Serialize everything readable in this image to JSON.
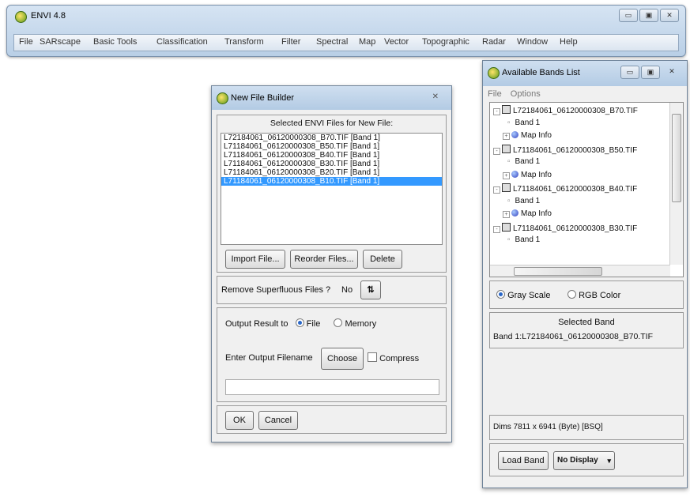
{
  "envi": {
    "title": "ENVI 4.8",
    "menu": [
      "File",
      "SARscape",
      "Basic Tools",
      "Classification",
      "Transform",
      "Filter",
      "Spectral",
      "Map",
      "Vector",
      "Topographic",
      "Radar",
      "Window",
      "Help"
    ],
    "controls": [
      "▭",
      "▣",
      "✕"
    ]
  },
  "new_file_builder": {
    "title": "New File Builder",
    "close": "✕",
    "selected_label": "Selected ENVI Files for New File:",
    "files": [
      "L72184061_06120000308_B70.TIF [Band 1]",
      "L71184061_06120000308_B50.TIF [Band 1]",
      "L71184061_06120000308_B40.TIF [Band 1]",
      "L71184061_06120000308_B30.TIF [Band 1]",
      "L71184061_06120000308_B20.TIF [Band 1]",
      "L71184061_06120000308_B10.TIF [Band 1]"
    ],
    "selected_index": 5,
    "import_button": "Import File...",
    "reorder_button": "Reorder Files...",
    "delete_button": "Delete",
    "remove_label": "Remove Superfluous Files ?",
    "remove_value": "No",
    "toggle_glyph": "⇅",
    "output_label": "Output Result to",
    "output_file": "File",
    "output_memory": "Memory",
    "output_selected": "File",
    "filename_label": "Enter Output Filename",
    "choose_button": "Choose",
    "compress_label": "Compress",
    "filename_value": "",
    "ok_button": "OK",
    "cancel_button": "Cancel"
  },
  "bands_list": {
    "title": "Available Bands List",
    "controls": [
      "▭",
      "▣",
      "✕"
    ],
    "menu": [
      "File",
      "Options"
    ],
    "tree": [
      {
        "type": "file",
        "label": "L72184061_06120000308_B70.TIF"
      },
      {
        "type": "band",
        "label": "Band 1"
      },
      {
        "type": "mapinfo",
        "label": "Map Info"
      },
      {
        "type": "file",
        "label": "L71184061_06120000308_B50.TIF"
      },
      {
        "type": "band",
        "label": "Band 1"
      },
      {
        "type": "mapinfo",
        "label": "Map Info"
      },
      {
        "type": "file",
        "label": "L71184061_06120000308_B40.TIF"
      },
      {
        "type": "band",
        "label": "Band 1"
      },
      {
        "type": "mapinfo",
        "label": "Map Info"
      },
      {
        "type": "file",
        "label": "L71184061_06120000308_B30.TIF"
      },
      {
        "type": "band",
        "label": "Band 1"
      }
    ],
    "gray_scale": "Gray Scale",
    "rgb_color": "RGB Color",
    "color_mode": "Gray Scale",
    "selected_band_title": "Selected Band",
    "selected_band_value": "Band 1:L72184061_06120000308_B70.TIF",
    "dims": "Dims  7811 x 6941 (Byte) [BSQ]",
    "load_button": "Load Band",
    "display_select": "No Display"
  }
}
